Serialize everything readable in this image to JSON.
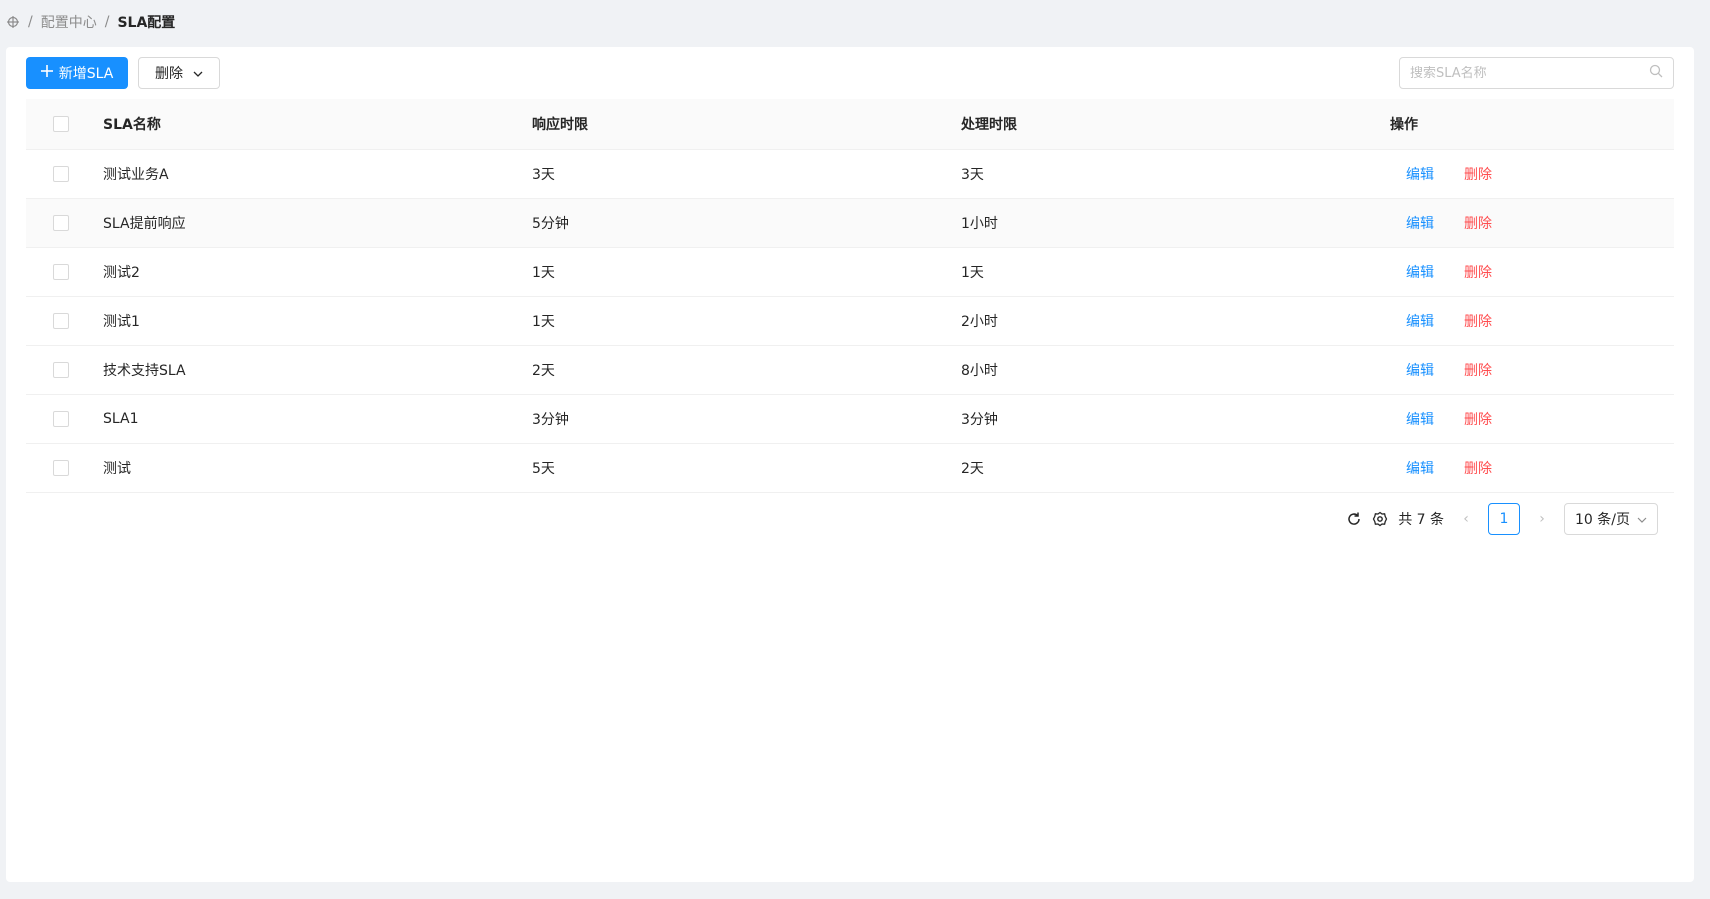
{
  "breadcrumb": {
    "parent": "配置中心",
    "current": "SLA配置",
    "separator": "/"
  },
  "toolbar": {
    "add_label": "新增SLA",
    "delete_label": "删除",
    "search_placeholder": "搜索SLA名称"
  },
  "table": {
    "columns": [
      "SLA名称",
      "响应时限",
      "处理时限",
      "操作"
    ],
    "edit_label": "编辑",
    "delete_label": "删除",
    "rows": [
      {
        "name": "测试业务A",
        "response": "3天",
        "process": "3天"
      },
      {
        "name": "SLA提前响应",
        "response": "5分钟",
        "process": "1小时"
      },
      {
        "name": "测试2",
        "response": "1天",
        "process": "1天"
      },
      {
        "name": "测试1",
        "response": "1天",
        "process": "2小时"
      },
      {
        "name": "技术支持SLA",
        "response": "2天",
        "process": "8小时"
      },
      {
        "name": "SLA1",
        "response": "3分钟",
        "process": "3分钟"
      },
      {
        "name": "测试",
        "response": "5天",
        "process": "2天"
      }
    ]
  },
  "pager": {
    "total": "共 7 条",
    "current_page": "1",
    "page_size": "10 条/页"
  },
  "colors": {
    "primary": "#1890ff",
    "danger": "#ff4d4f"
  }
}
